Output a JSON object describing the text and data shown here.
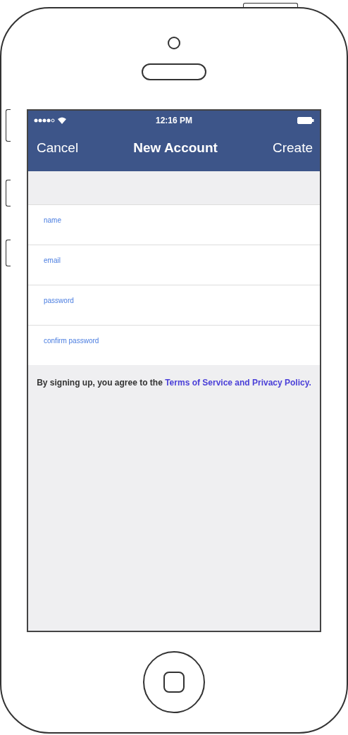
{
  "status_bar": {
    "time": "12:16 PM"
  },
  "nav_bar": {
    "left_button": "Cancel",
    "title": "New Account",
    "right_button": "Create"
  },
  "fields": [
    {
      "placeholder": "name"
    },
    {
      "placeholder": "email"
    },
    {
      "placeholder": "password"
    },
    {
      "placeholder": "confirm password"
    }
  ],
  "terms": {
    "text": "By signing up, you agree to the ",
    "link": "Terms of Service and Privacy Policy."
  }
}
